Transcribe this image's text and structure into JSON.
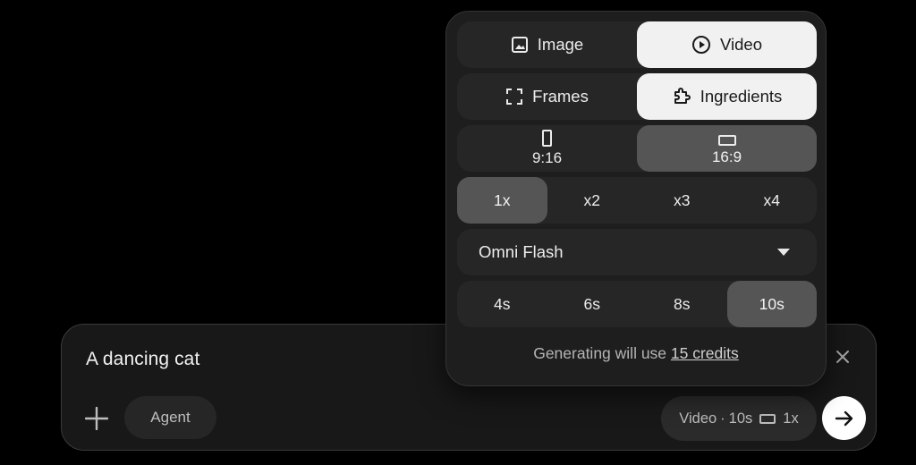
{
  "prompt": {
    "text": "A dancing cat",
    "agent_label": "Agent",
    "settings_summary": {
      "mode": "Video",
      "separator": "·",
      "duration": "10s",
      "count": "1x"
    }
  },
  "popover": {
    "type_options": [
      {
        "label": "Image",
        "icon": "image-icon",
        "selected": false
      },
      {
        "label": "Video",
        "icon": "play-circle-icon",
        "selected": true
      }
    ],
    "mode_options": [
      {
        "label": "Frames",
        "icon": "frames-icon",
        "selected": false
      },
      {
        "label": "Ingredients",
        "icon": "ingredients-icon",
        "selected": true
      }
    ],
    "aspect_options": [
      {
        "label": "9:16",
        "icon": "portrait-icon",
        "selected": false
      },
      {
        "label": "16:9",
        "icon": "landscape-icon",
        "selected": true
      }
    ],
    "count_options": [
      {
        "label": "1x",
        "selected": true
      },
      {
        "label": "x2",
        "selected": false
      },
      {
        "label": "x3",
        "selected": false
      },
      {
        "label": "x4",
        "selected": false
      }
    ],
    "model": {
      "label": "Omni Flash"
    },
    "duration_options": [
      {
        "label": "4s",
        "selected": false
      },
      {
        "label": "6s",
        "selected": false
      },
      {
        "label": "8s",
        "selected": false
      },
      {
        "label": "10s",
        "selected": true
      }
    ],
    "credit_note": {
      "prefix": "Generating will use",
      "link": "15 credits"
    }
  },
  "colors": {
    "background": "#000000",
    "panel": "#1e1e1e",
    "selected_light": "#f1f1f1",
    "selected_dark": "#555555"
  }
}
